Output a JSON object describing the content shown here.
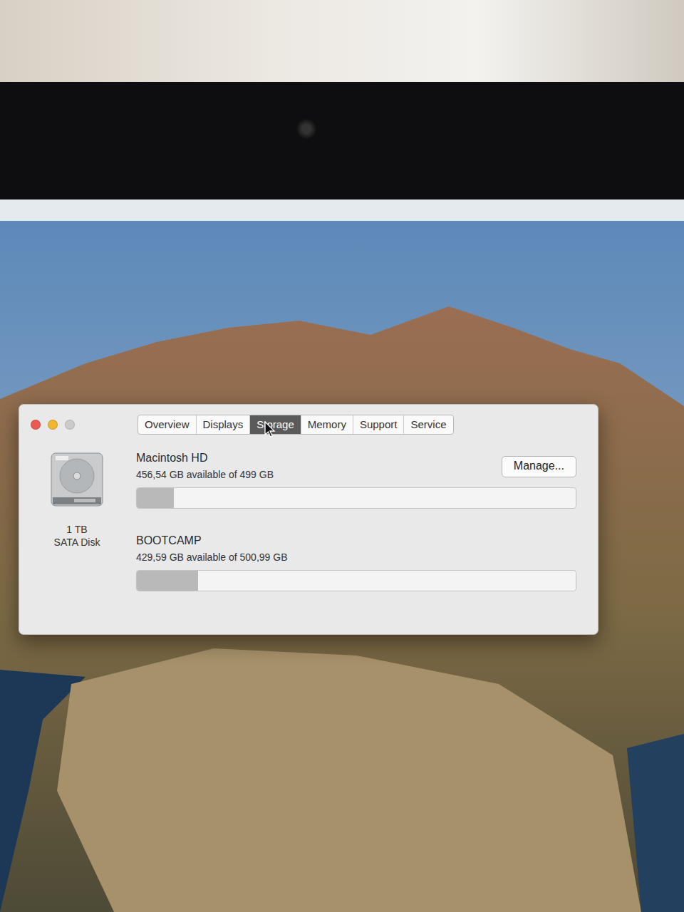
{
  "window": {
    "traffic_lights": [
      {
        "kind": "close",
        "color": "#ec5b52",
        "disabled": false
      },
      {
        "kind": "minimize",
        "color": "#f2b632",
        "disabled": false
      },
      {
        "kind": "zoom",
        "color": "#c4c4c4",
        "disabled": true
      }
    ]
  },
  "tabs": [
    {
      "label": "Overview",
      "selected": false,
      "hovered": false
    },
    {
      "label": "Displays",
      "selected": false,
      "hovered": false
    },
    {
      "label": "Storage",
      "selected": true,
      "hovered": true
    },
    {
      "label": "Memory",
      "selected": false,
      "hovered": false
    },
    {
      "label": "Support",
      "selected": false,
      "hovered": false
    },
    {
      "label": "Service",
      "selected": false,
      "hovered": false
    }
  ],
  "disk": {
    "size": "1 TB",
    "type": "SATA Disk"
  },
  "volumes": [
    {
      "name": "Macintosh HD",
      "available": "456,54 GB available of 499 GB",
      "level": 0.085,
      "button": "Manage..."
    },
    {
      "name": "BOOTCAMP",
      "available": "429,59 GB available of 500,99 GB",
      "level": 0.14
    }
  ]
}
